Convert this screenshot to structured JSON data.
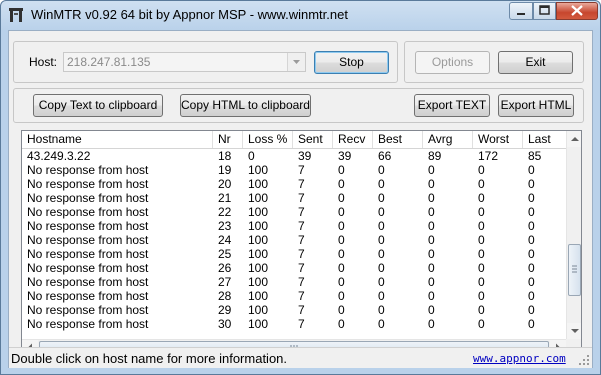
{
  "window": {
    "title": "WinMTR v0.92 64 bit by Appnor MSP - www.winmtr.net"
  },
  "host": {
    "label": "Host:",
    "value": "218.247.81.135"
  },
  "buttons": {
    "stop": "Stop",
    "options": "Options",
    "exit": "Exit",
    "copy_text": "Copy Text to clipboard",
    "copy_html": "Copy HTML to clipboard",
    "export_text": "Export TEXT",
    "export_html": "Export HTML"
  },
  "table": {
    "columns": [
      "Hostname",
      "Nr",
      "Loss %",
      "Sent",
      "Recv",
      "Best",
      "Avrg",
      "Worst",
      "Last"
    ],
    "rows": [
      [
        "43.249.3.22",
        "18",
        "0",
        "39",
        "39",
        "66",
        "89",
        "172",
        "85"
      ],
      [
        "No response from host",
        "19",
        "100",
        "7",
        "0",
        "0",
        "0",
        "0",
        "0"
      ],
      [
        "No response from host",
        "20",
        "100",
        "7",
        "0",
        "0",
        "0",
        "0",
        "0"
      ],
      [
        "No response from host",
        "21",
        "100",
        "7",
        "0",
        "0",
        "0",
        "0",
        "0"
      ],
      [
        "No response from host",
        "22",
        "100",
        "7",
        "0",
        "0",
        "0",
        "0",
        "0"
      ],
      [
        "No response from host",
        "23",
        "100",
        "7",
        "0",
        "0",
        "0",
        "0",
        "0"
      ],
      [
        "No response from host",
        "24",
        "100",
        "7",
        "0",
        "0",
        "0",
        "0",
        "0"
      ],
      [
        "No response from host",
        "25",
        "100",
        "7",
        "0",
        "0",
        "0",
        "0",
        "0"
      ],
      [
        "No response from host",
        "26",
        "100",
        "7",
        "0",
        "0",
        "0",
        "0",
        "0"
      ],
      [
        "No response from host",
        "27",
        "100",
        "7",
        "0",
        "0",
        "0",
        "0",
        "0"
      ],
      [
        "No response from host",
        "28",
        "100",
        "7",
        "0",
        "0",
        "0",
        "0",
        "0"
      ],
      [
        "No response from host",
        "29",
        "100",
        "7",
        "0",
        "0",
        "0",
        "0",
        "0"
      ],
      [
        "No response from host",
        "30",
        "100",
        "7",
        "0",
        "0",
        "0",
        "0",
        "0"
      ]
    ]
  },
  "status": {
    "text": "Double click on host name for more information.",
    "link": "www.appnor.com"
  },
  "icons": {
    "app": "network-tool-icon",
    "minimize": "minimize-icon",
    "maximize": "maximize-icon",
    "close": "close-icon"
  },
  "colors": {
    "link": "#0000c0",
    "title_bar": "#b9d1ea",
    "close_button": "#c7462e"
  }
}
